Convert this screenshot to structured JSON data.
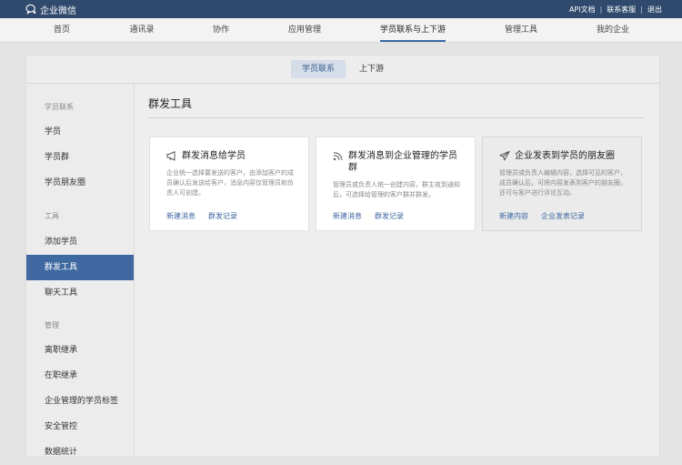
{
  "app": {
    "name": "企业微信"
  },
  "top_links": [
    "API文档",
    "联系客服",
    "退出"
  ],
  "main_nav": [
    "首页",
    "通讯录",
    "协作",
    "应用管理",
    "学员联系与上下游",
    "管理工具",
    "我的企业"
  ],
  "sub_tabs": [
    "学员联系",
    "上下游"
  ],
  "sidebar": {
    "groups": [
      {
        "label": "学员联系",
        "items": [
          "学员",
          "学员群",
          "学员朋友圈"
        ]
      },
      {
        "label": "工具",
        "items": [
          "添加学员",
          "群发工具",
          "聊天工具"
        ]
      },
      {
        "label": "管理",
        "items": [
          "离职继承",
          "在职继承",
          "企业管理的学员标签",
          "安全管控",
          "数据统计"
        ]
      }
    ],
    "active_item": "群发工具"
  },
  "content": {
    "title": "群发工具",
    "cards": [
      {
        "title": "群发消息给学员",
        "icon": "megaphone-icon",
        "desc": "企业统一选择要发送的客户，由添加客户的成员确认后发送给客户，消息内容仅管理员和负责人可创建。",
        "links": [
          "新建消息",
          "群发记录"
        ]
      },
      {
        "title": "群发消息到企业管理的学员群",
        "icon": "broadcast-icon",
        "desc": "管理员或负责人统一创建内容，群主收到通知后，可选择给管理的客户群并群发。",
        "links": [
          "新建消息",
          "群发记录"
        ]
      },
      {
        "title": "企业发表到学员的朋友圈",
        "icon": "paper-plane-icon",
        "desc": "管理员或负责人编辑内容，选择可见的客户，成员确认后，可将内容发表到客户的朋友圈，还可与客户进行评论互动。",
        "links": [
          "新建内容",
          "企业发表记录"
        ]
      }
    ]
  }
}
